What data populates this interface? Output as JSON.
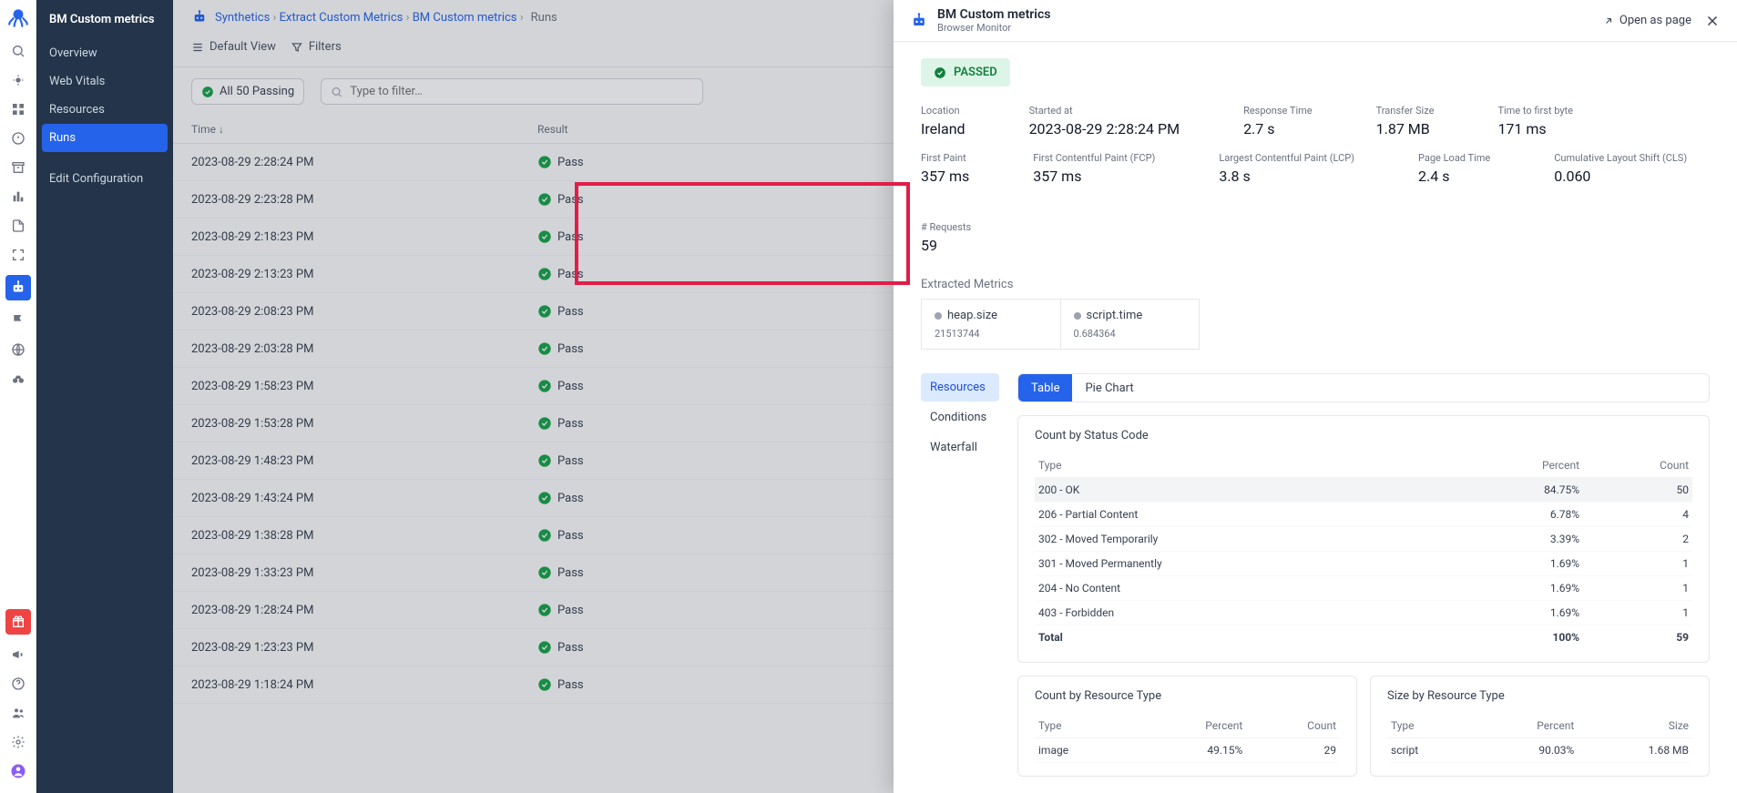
{
  "sidebar": {
    "title": "BM Custom metrics",
    "items": [
      "Overview",
      "Web Vitals",
      "Resources",
      "Runs",
      "Edit Configuration"
    ],
    "active_index": 3
  },
  "breadcrumbs": {
    "items": [
      "Synthetics",
      "Extract Custom Metrics",
      "BM Custom metrics"
    ],
    "current": "Runs"
  },
  "toolbar": {
    "default_view": "Default View",
    "filters": "Filters"
  },
  "filters": {
    "passing_badge": "All 50 Passing",
    "search_placeholder": "Type to filter…"
  },
  "runs_table": {
    "col_time": "Time ↓",
    "col_result": "Result",
    "result_label": "Pass",
    "rows": [
      "2023-08-29 2:28:24 PM",
      "2023-08-29 2:23:28 PM",
      "2023-08-29 2:18:23 PM",
      "2023-08-29 2:13:23 PM",
      "2023-08-29 2:08:23 PM",
      "2023-08-29 2:03:28 PM",
      "2023-08-29 1:58:23 PM",
      "2023-08-29 1:53:28 PM",
      "2023-08-29 1:48:23 PM",
      "2023-08-29 1:43:24 PM",
      "2023-08-29 1:38:28 PM",
      "2023-08-29 1:33:23 PM",
      "2023-08-29 1:28:24 PM",
      "2023-08-29 1:23:23 PM",
      "2023-08-29 1:18:24 PM"
    ]
  },
  "panel": {
    "title": "BM Custom metrics",
    "subtitle": "Browser Monitor",
    "open_as_page": "Open as page",
    "status": "PASSED",
    "metrics_row1": [
      {
        "label": "Location",
        "value": "Ireland"
      },
      {
        "label": "Started at",
        "value": "2023-08-29 2:28:24 PM"
      },
      {
        "label": "Response Time",
        "value": "2.7 s"
      },
      {
        "label": "Transfer Size",
        "value": "1.87 MB"
      },
      {
        "label": "Time to first byte",
        "value": "171 ms"
      }
    ],
    "metrics_row2": [
      {
        "label": "First Paint",
        "value": "357 ms"
      },
      {
        "label": "First Contentful Paint (FCP)",
        "value": "357 ms"
      },
      {
        "label": "Largest Contentful Paint (LCP)",
        "value": "3.8 s"
      },
      {
        "label": "Page Load Time",
        "value": "2.4 s"
      },
      {
        "label": "Cumulative Layout Shift (CLS)",
        "value": "0.060"
      },
      {
        "label": "# Requests",
        "value": "59"
      }
    ],
    "extracted_title": "Extracted Metrics",
    "extracted": [
      {
        "name": "heap.size",
        "value": "21513744"
      },
      {
        "name": "script.time",
        "value": "0.684364"
      }
    ],
    "vtabs": [
      "Resources",
      "Conditions",
      "Waterfall"
    ],
    "vchips": [
      "Table",
      "Pie Chart"
    ],
    "status_card_title": "Count by Status Code",
    "status_cols": [
      "Type",
      "Percent",
      "Count"
    ],
    "status_rows": [
      {
        "type": "200 - OK",
        "percent": "84.75%",
        "count": "50",
        "hl": true
      },
      {
        "type": "206 - Partial Content",
        "percent": "6.78%",
        "count": "4"
      },
      {
        "type": "302 - Moved Temporarily",
        "percent": "3.39%",
        "count": "2"
      },
      {
        "type": "301 - Moved Permanently",
        "percent": "1.69%",
        "count": "1"
      },
      {
        "type": "204 - No Content",
        "percent": "1.69%",
        "count": "1"
      },
      {
        "type": "403 - Forbidden",
        "percent": "1.69%",
        "count": "1"
      }
    ],
    "status_total": {
      "label": "Total",
      "percent": "100%",
      "count": "59"
    },
    "res_type_title": "Count by Resource Type",
    "res_type_cols": [
      "Type",
      "Percent",
      "Count"
    ],
    "res_type_rows": [
      {
        "type": "image",
        "percent": "49.15%",
        "count": "29"
      }
    ],
    "size_type_title": "Size by Resource Type",
    "size_type_cols": [
      "Type",
      "Percent",
      "Size"
    ],
    "size_type_rows": [
      {
        "type": "script",
        "percent": "90.03%",
        "size": "1.68 MB"
      }
    ]
  }
}
